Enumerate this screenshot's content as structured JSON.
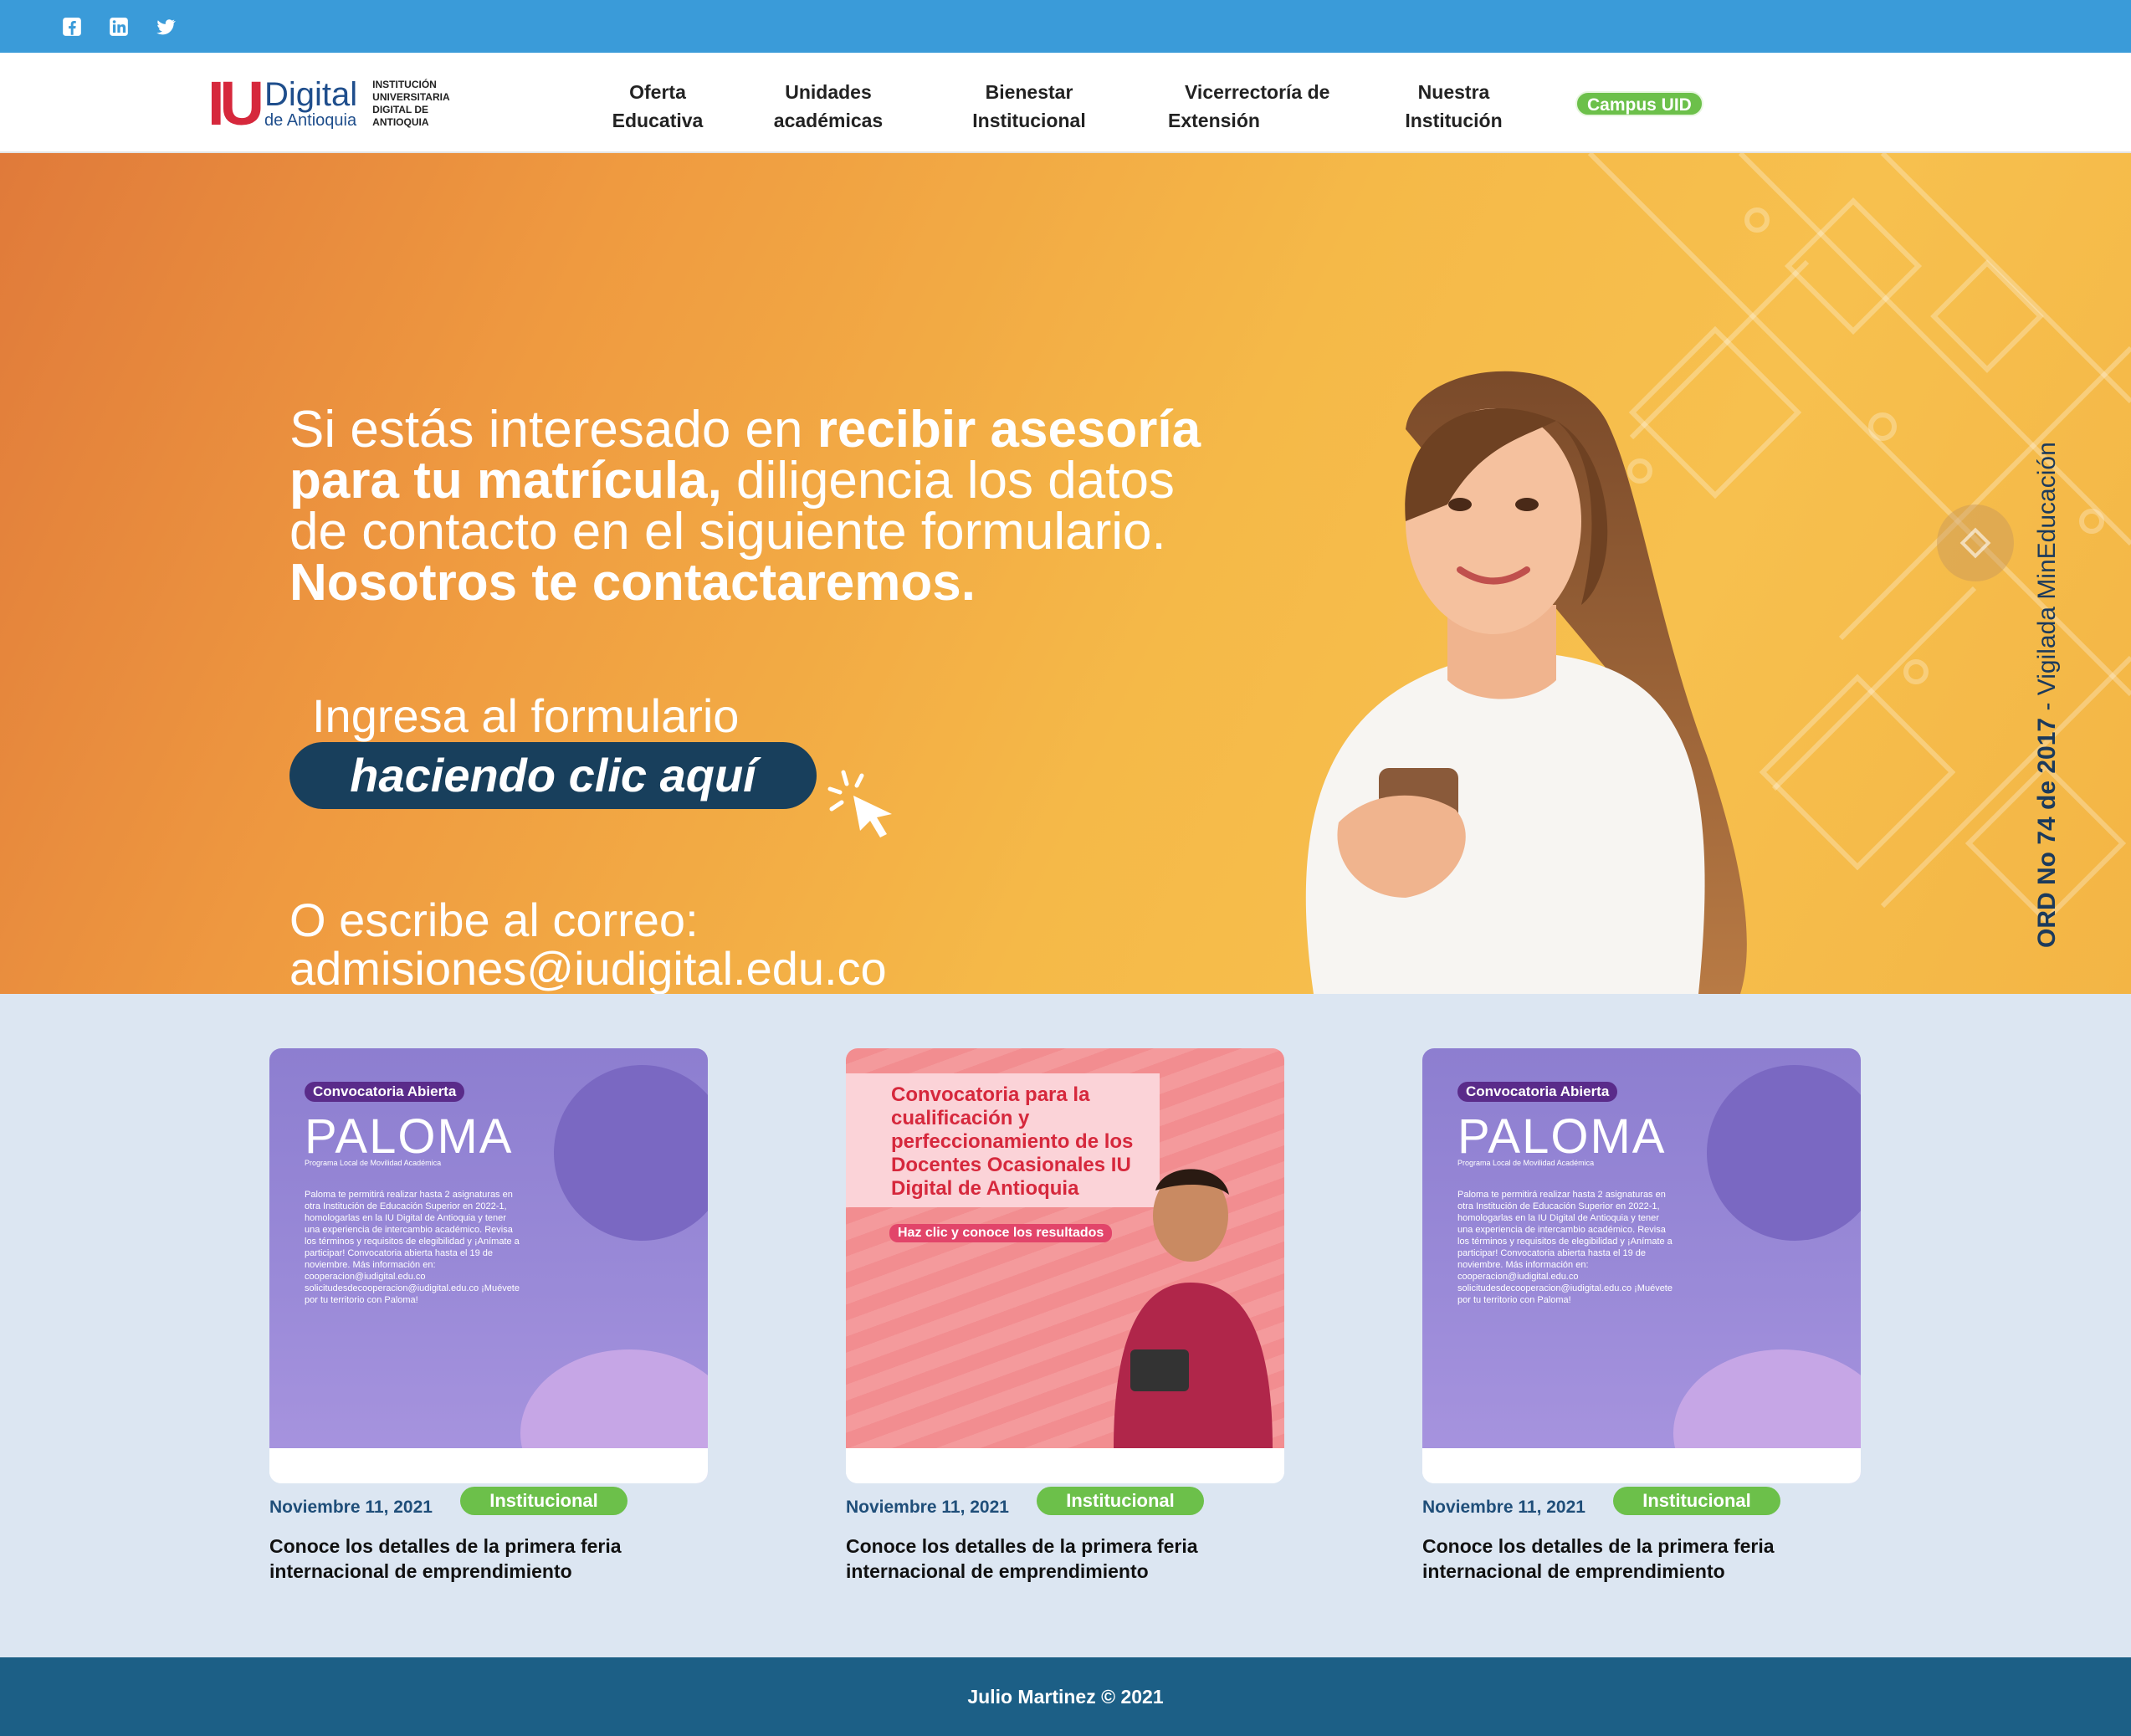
{
  "social": {
    "icons": [
      "facebook-icon",
      "linkedin-icon",
      "twitter-icon"
    ],
    "color": "#3a9bd9"
  },
  "logo": {
    "iu": "IU",
    "digital": "Digital",
    "region": "de Antioquia",
    "subtitle": "INSTITUCIÓN UNIVERSITARIA DIGITAL DE ANTIOQUIA"
  },
  "nav": {
    "items": [
      {
        "line1": "Oferta",
        "line2": "Educativa"
      },
      {
        "line1": "Unidades",
        "line2": "académicas"
      },
      {
        "line1": "Bienestar",
        "line2": "Institucional"
      },
      {
        "line1": "Vicerrectoría de",
        "line2": "Extensión"
      },
      {
        "line1": "Nuestra",
        "line2": "Institución"
      }
    ],
    "campus": "Campus UID",
    "campus_color": "#6cc04a"
  },
  "hero": {
    "l1_normal": "Si estás interesado en ",
    "l1_bold": "recibir asesoría",
    "l2_bold": "para tu matrícula,",
    "l2_normal": " diligencia los datos",
    "l3": "de contacto en el siguiente formulario.",
    "l4_bold": "Nosotros te contactaremos.",
    "ingresa": "Ingresa al formulario",
    "cta": "haciendo clic aquí",
    "escribe": "O escribe al correo:",
    "email": "admisiones@iudigital.edu.co",
    "vertical_bold": "ORD No 74 de 2017",
    "vertical_normal": " - Vigilada MinEducación"
  },
  "cards": [
    {
      "art": {
        "badge": "Convocatoria Abierta",
        "big": "PALOMA",
        "small": "Programa Local de Movilidad Académica",
        "para": "Paloma te permitirá realizar hasta 2 asignaturas en otra Institución de Educación Superior en 2022-1, homologarlas en la IU Digital de Antioquia y tener una experiencia de intercambio académico. Revisa los términos y requisitos de elegibilidad y ¡Anímate a participar! Convocatoria abierta hasta el 19 de noviembre. Más información en: cooperacion@iudigital.edu.co solicitudesdecooperacion@iudigital.edu.co ¡Muévete por tu territorio con Paloma!"
      },
      "date": "Noviembre 11, 2021",
      "tag": "Institucional",
      "title": "Conoce los detalles de la primera feria internacional de emprendimiento"
    },
    {
      "art": {
        "title": "Convocatoria para la cualificación y perfeccionamiento de los Docentes Ocasionales IU Digital de Antioquia",
        "cta": "Haz clic y conoce los resultados"
      },
      "date": "Noviembre 11, 2021",
      "tag": "Institucional",
      "title": "Conoce los detalles de la primera feria internacional de emprendimiento"
    },
    {
      "art": {
        "badge": "Convocatoria Abierta",
        "big": "PALOMA",
        "small": "Programa Local de Movilidad Académica",
        "para": "Paloma te permitirá realizar hasta 2 asignaturas en otra Institución de Educación Superior en 2022-1, homologarlas en la IU Digital de Antioquia y tener una experiencia de intercambio académico. Revisa los términos y requisitos de elegibilidad y ¡Anímate a participar! Convocatoria abierta hasta el 19 de noviembre. Más información en: cooperacion@iudigital.edu.co solicitudesdecooperacion@iudigital.edu.co ¡Muévete por tu territorio con Paloma!"
      },
      "date": "Noviembre 11, 2021",
      "tag": "Institucional",
      "title": "Conoce los detalles de la primera feria internacional de emprendimiento"
    }
  ],
  "footer": {
    "text": "Julio Martinez © 2021",
    "color": "#1c5f86"
  }
}
